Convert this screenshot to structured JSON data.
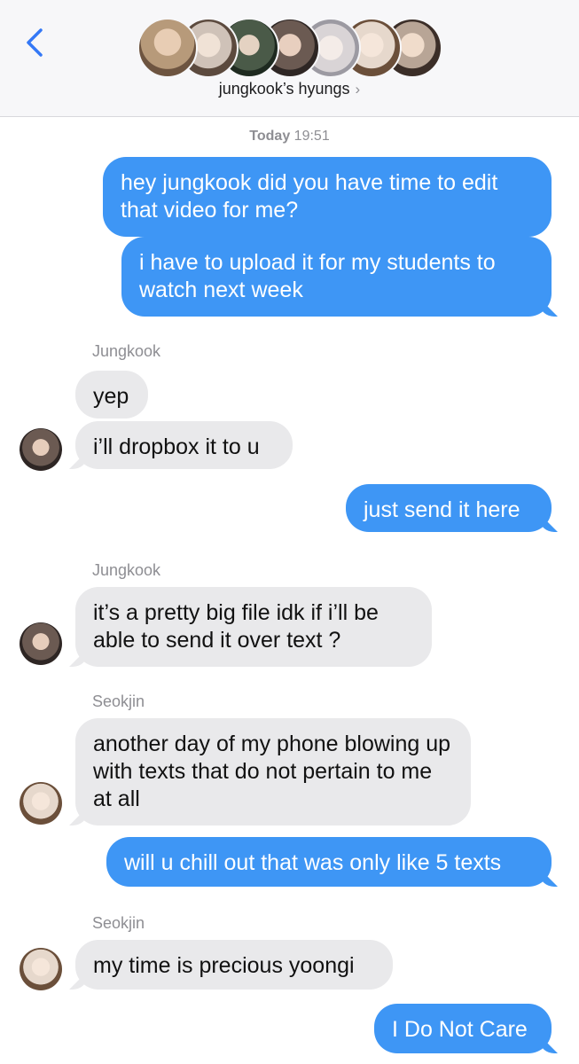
{
  "header": {
    "group_name": "jungkook’s hyungs",
    "chevron": "›",
    "back_icon": "chevron-left-icon",
    "member_avatar_colors": [
      "#b79a7a",
      "#cfc2b8",
      "#4a5a48",
      "#6b5a52",
      "#d9d4d6",
      "#e6d8cc",
      "#b8a596"
    ]
  },
  "timestamp": {
    "day": "Today",
    "time": "19:51"
  },
  "messages": [
    {
      "side": "out",
      "text": "hey jungkook did you have time to edit that video for me?"
    },
    {
      "side": "out",
      "text": "i have to upload it for my students to watch next week"
    },
    {
      "side": "in",
      "sender": "Jungkook",
      "text": "yep"
    },
    {
      "side": "in",
      "text": "i’ll dropbox it to u"
    },
    {
      "side": "out",
      "text": "just send it here"
    },
    {
      "side": "in",
      "sender": "Jungkook",
      "text": "it’s a pretty big file idk if i’ll be able to send it over text ?"
    },
    {
      "side": "in",
      "sender": "Seokjin",
      "text": "another day of my phone blowing up with texts that do not pertain to me at all"
    },
    {
      "side": "out",
      "text": "will u chill out that was only like 5 texts"
    },
    {
      "side": "in",
      "sender": "Seokjin",
      "text": "my time is precious yoongi"
    },
    {
      "side": "out",
      "text": "I Do Not Care"
    }
  ],
  "colors": {
    "outgoing": "#3e96f5",
    "incoming": "#e9e9eb",
    "accent": "#3478f6"
  }
}
